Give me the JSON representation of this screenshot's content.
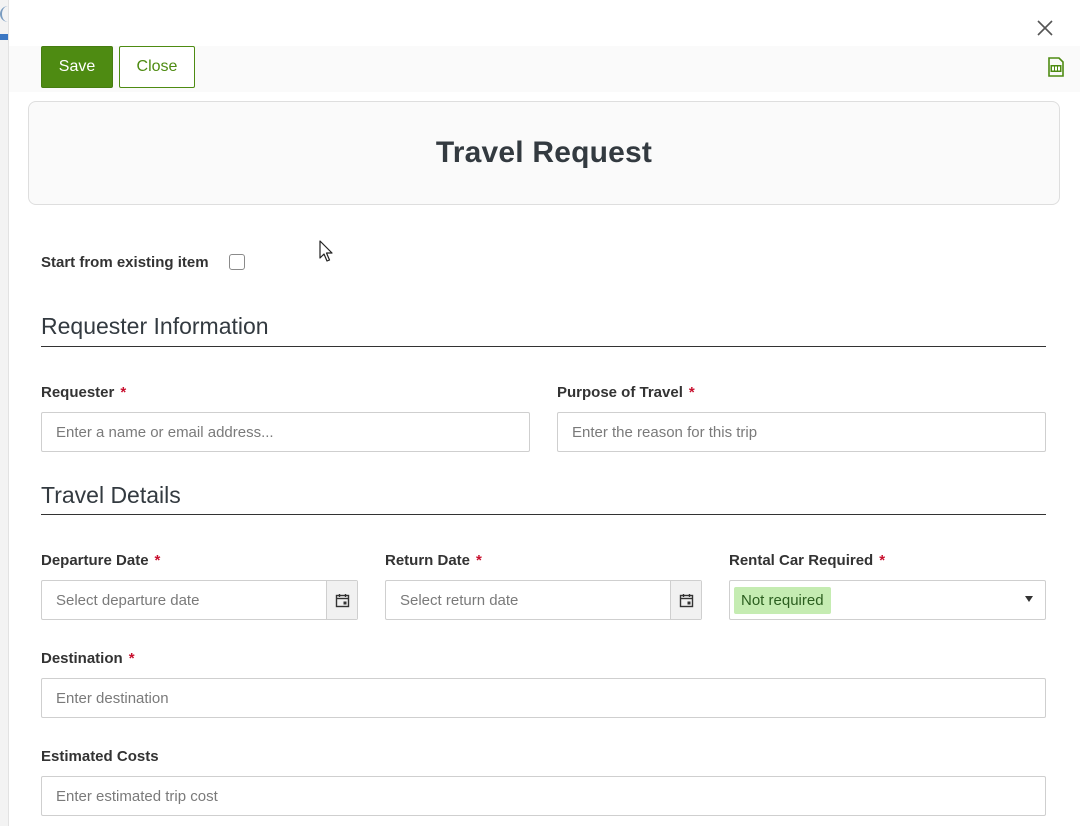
{
  "toolbar": {
    "save_label": "Save",
    "close_label": "Close"
  },
  "form": {
    "title": "Travel Request",
    "start_existing_label": "Start from existing item",
    "sections": {
      "requester": "Requester Information",
      "travel": "Travel Details"
    },
    "required_mark": "*",
    "fields": {
      "requester": {
        "label": "Requester",
        "placeholder": "Enter a name or email address..."
      },
      "purpose": {
        "label": "Purpose of Travel",
        "placeholder": "Enter the reason for this trip"
      },
      "departure": {
        "label": "Departure Date",
        "placeholder": "Select departure date"
      },
      "return": {
        "label": "Return Date",
        "placeholder": "Select return date"
      },
      "rental_car": {
        "label": "Rental Car Required",
        "value": "Not required"
      },
      "destination": {
        "label": "Destination",
        "placeholder": "Enter destination"
      },
      "costs": {
        "label": "Estimated Costs",
        "placeholder": "Enter estimated trip cost"
      }
    }
  },
  "colors": {
    "accent": "#4e8b12",
    "required": "#c8102e",
    "pill_bg": "#c5ecb2"
  },
  "icons": [
    "close-icon",
    "pdf-icon",
    "calendar-icon",
    "chevron-down-icon",
    "mouse-cursor-icon"
  ]
}
